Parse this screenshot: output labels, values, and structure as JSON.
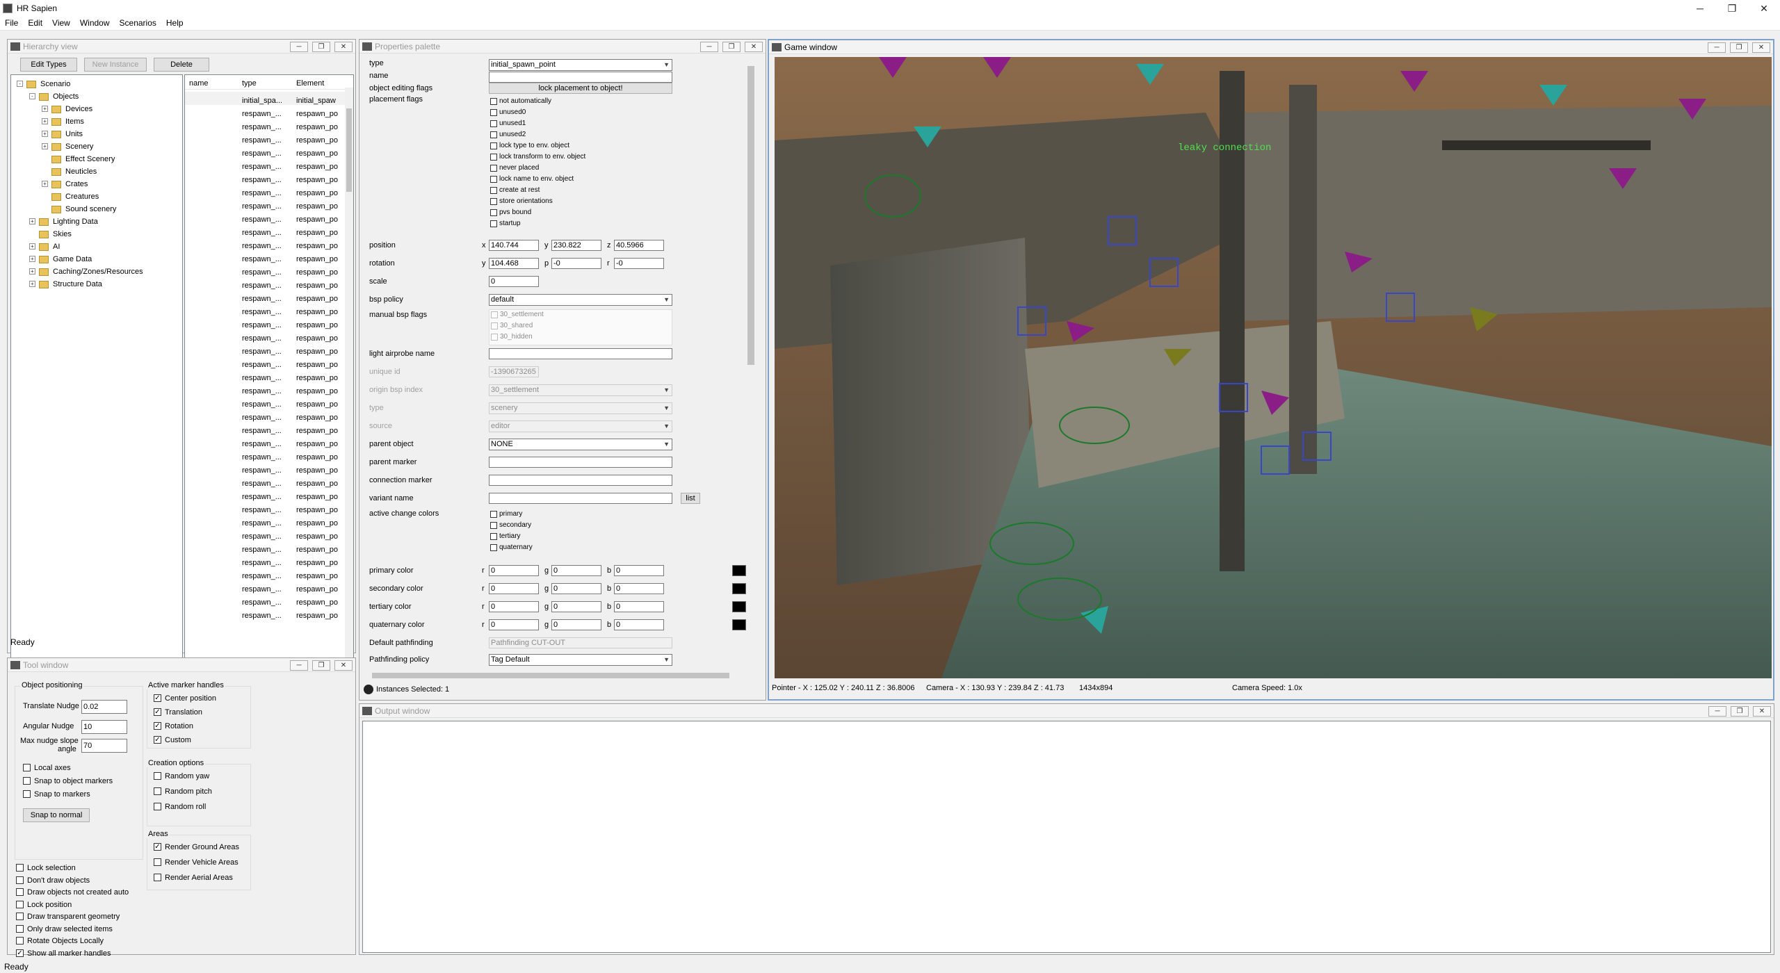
{
  "app": {
    "title": "HR Sapien",
    "min": "─",
    "max": "❐",
    "close": "✕"
  },
  "menu": [
    "File",
    "Edit",
    "View",
    "Window",
    "Scenarios",
    "Help"
  ],
  "hierarchy": {
    "title": "Hierarchy view",
    "buttons": {
      "edit_types": "Edit Types",
      "new_instance": "New Instance",
      "delete": "Delete"
    },
    "tree": [
      {
        "label": "Scenario",
        "level": 0,
        "exp": "-"
      },
      {
        "label": "Objects",
        "level": 1,
        "exp": "-"
      },
      {
        "label": "Devices",
        "level": 2,
        "exp": "+"
      },
      {
        "label": "Items",
        "level": 2,
        "exp": "+"
      },
      {
        "label": "Units",
        "level": 2,
        "exp": "+"
      },
      {
        "label": "Scenery",
        "level": 2,
        "exp": "+"
      },
      {
        "label": "Effect Scenery",
        "level": 2,
        "exp": ""
      },
      {
        "label": "Neuticles",
        "level": 2,
        "exp": ""
      },
      {
        "label": "Crates",
        "level": 2,
        "exp": "+"
      },
      {
        "label": "Creatures",
        "level": 2,
        "exp": ""
      },
      {
        "label": "Sound scenery",
        "level": 2,
        "exp": ""
      },
      {
        "label": "Lighting Data",
        "level": 1,
        "exp": "+"
      },
      {
        "label": "Skies",
        "level": 1,
        "exp": ""
      },
      {
        "label": "AI",
        "level": 1,
        "exp": "+"
      },
      {
        "label": "Game Data",
        "level": 1,
        "exp": "+"
      },
      {
        "label": "Caching/Zones/Resources",
        "level": 1,
        "exp": "+"
      },
      {
        "label": "Structure Data",
        "level": 1,
        "exp": "+"
      }
    ],
    "columns": {
      "name": "name",
      "type": "type",
      "element": "Element"
    },
    "first_row": {
      "type": "initial_spa...",
      "element": "initial_spaw"
    },
    "row_type": "respawn_...",
    "row_element": "respawn_po",
    "status": "Ready"
  },
  "properties": {
    "title": "Properties palette",
    "type_label": "type",
    "type_value": "initial_spawn_point",
    "name_label": "name",
    "editing_flags_label": "object editing flags",
    "lock_placement": "lock placement to object!",
    "placement_flags_label": "placement flags",
    "placement_flags": [
      "not automatically",
      "unused0",
      "unused1",
      "unused2",
      "lock type to env. object",
      "lock transform to env. object",
      "never placed",
      "lock name to env. object",
      "create at rest",
      "store orientations",
      "pvs bound",
      "startup"
    ],
    "position_label": "position",
    "position": {
      "x": "140.744",
      "y": "230.822",
      "z": "40.5966"
    },
    "rotation_label": "rotation",
    "rotation": {
      "y": "104.468",
      "p": "-0",
      "r": "-0"
    },
    "scale_label": "scale",
    "scale": "0",
    "bsp_policy_label": "bsp policy",
    "bsp_policy": "default",
    "manual_bsp_label": "manual bsp flags",
    "manual_bsp": [
      "30_settlement",
      "30_shared",
      "30_hidden"
    ],
    "light_airprobe_label": "light airprobe name",
    "unique_id_label": "unique id",
    "unique_id": "-1390673265",
    "origin_bsp_label": "origin bsp index",
    "origin_bsp": "30_settlement",
    "type2_label": "type",
    "type2": "scenery",
    "source_label": "source",
    "source": "editor",
    "parent_object_label": "parent object",
    "parent_object": "NONE",
    "parent_marker_label": "parent marker",
    "connection_marker_label": "connection marker",
    "variant_name_label": "variant name",
    "list_button": "list",
    "active_colors_label": "active change colors",
    "active_colors": [
      "primary",
      "secondary",
      "tertiary",
      "quaternary"
    ],
    "color_rows": [
      {
        "label": "primary color",
        "r": "0",
        "g": "0",
        "b": "0"
      },
      {
        "label": "secondary color",
        "r": "0",
        "g": "0",
        "b": "0"
      },
      {
        "label": "tertiary color",
        "r": "0",
        "g": "0",
        "b": "0"
      },
      {
        "label": "quaternary color",
        "r": "0",
        "g": "0",
        "b": "0"
      }
    ],
    "default_pathfinding_label": "Default pathfinding",
    "default_pathfinding": "Pathfinding CUT-OUT",
    "pathfinding_policy_label": "Pathfinding policy",
    "pathfinding_policy": "Tag Default",
    "instances_selected": "Instances Selected: 1",
    "axis": {
      "x": "x",
      "y": "y",
      "z": "z",
      "p": "p",
      "r": "r",
      "g": "g",
      "b": "b"
    }
  },
  "game": {
    "title": "Game window",
    "overlay_text": "leaky connection",
    "pointer": "Pointer - X : 125.02  Y : 240.11  Z : 36.8006",
    "camera": "Camera - X : 130.93  Y : 239.84  Z : 41.73",
    "resolution": "1434x894",
    "camera_speed": "Camera Speed: 1.0x"
  },
  "tool": {
    "title": "Tool window",
    "object_positioning": "Object positioning",
    "translate_label": "Translate Nudge",
    "translate": "0.02",
    "angular_label": "Angular Nudge",
    "angular": "10",
    "max_slope_label1": "Max nudge slope",
    "max_slope_label2": "angle",
    "max_slope": "70",
    "local_axes": "Local axes",
    "snap_object_markers": "Snap to object markers",
    "snap_markers": "Snap to markers",
    "snap_normal": "Snap to normal",
    "active_marker_handles": "Active marker handles",
    "handles": [
      {
        "label": "Center position",
        "checked": true
      },
      {
        "label": "Translation",
        "checked": true
      },
      {
        "label": "Rotation",
        "checked": true
      },
      {
        "label": "Custom",
        "checked": true
      }
    ],
    "creation_options": "Creation options",
    "creation": [
      "Random yaw",
      "Random pitch",
      "Random roll"
    ],
    "areas": "Areas",
    "area_opts": [
      {
        "label": "Render Ground Areas",
        "checked": true
      },
      {
        "label": "Render Vehicle Areas",
        "checked": false
      },
      {
        "label": "Render Aerial Areas",
        "checked": false
      }
    ],
    "bottom_opts": [
      {
        "label": "Lock selection",
        "checked": false
      },
      {
        "label": "Don't draw objects",
        "checked": false
      },
      {
        "label": "Draw objects not created auto",
        "checked": false
      },
      {
        "label": "Lock position",
        "checked": false
      },
      {
        "label": "Draw transparent geometry",
        "checked": false
      },
      {
        "label": "Only draw selected items",
        "checked": false
      },
      {
        "label": "Rotate Objects Locally",
        "checked": false
      },
      {
        "label": "Show all marker handles",
        "checked": true
      }
    ]
  },
  "output": {
    "title": "Output window"
  },
  "status": "Ready"
}
